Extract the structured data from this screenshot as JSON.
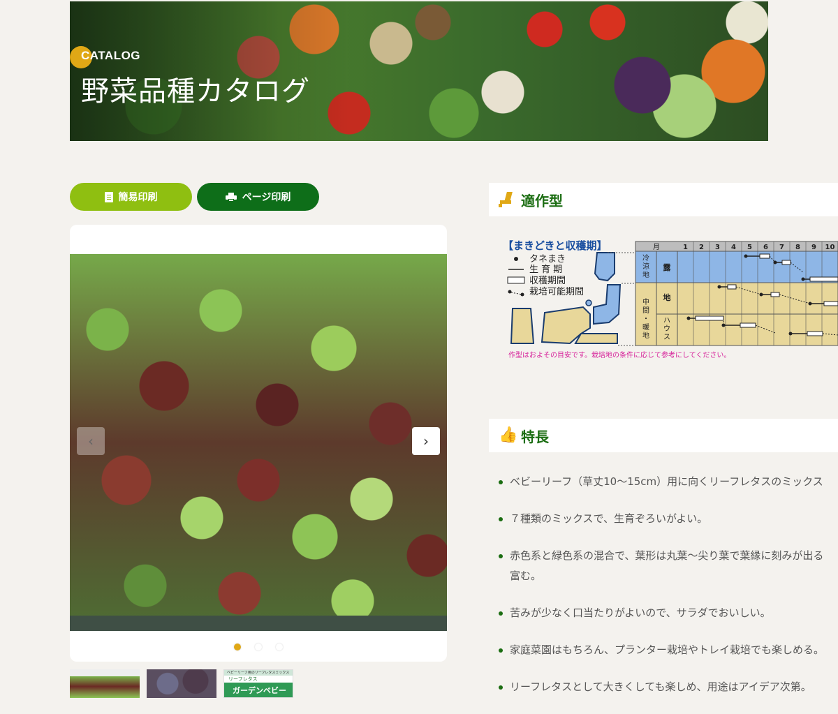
{
  "banner": {
    "category": "CATALOG",
    "title": "野菜品種カタログ"
  },
  "buttons": {
    "simple_print": "簡易印刷",
    "page_print": "ページ印刷"
  },
  "carousel": {
    "prev": "‹",
    "next": "›",
    "dots": 3,
    "active_dot": 1
  },
  "thumbnails": {
    "pkg_top": "ベビーリーフ用のリーフレタスミックス",
    "pkg_sub": "リーフレタス",
    "pkg_name": "ガーデンベビー"
  },
  "sections": {
    "cropping": {
      "title": "適作型"
    },
    "features": {
      "title": "特長"
    }
  },
  "cropping_chart": {
    "heading": "【まきどきと収穫期】",
    "legend": [
      "タネまき",
      "生 育 期",
      "収穫期間",
      "栽培可能期間"
    ],
    "month_label": "月",
    "months": [
      "1",
      "2",
      "3",
      "4",
      "5",
      "6",
      "7",
      "8",
      "9",
      "10"
    ],
    "regions": {
      "cold": "冷涼地",
      "mid": "中間・暖地"
    },
    "types": {
      "outdoor": "露",
      "ground": "地",
      "house": "ハウス"
    },
    "note": "作型はおよその目安です。栽培地の条件に応じて参考にしてください。",
    "colors": {
      "cold": "#8eb6e6",
      "mid": "#e8d79a",
      "header": "#bdbdbd"
    }
  },
  "features": [
    "ベビーリーフ（草丈10〜15cm）用に向くリーフレタスのミックス",
    "７種類のミックスで、生育ぞろいがよい。",
    "赤色系と緑色系の混合で、葉形は丸葉〜尖り葉で葉縁に刻みが出る",
    "富む。",
    "苦みが少なく口当たりがよいので、サラダでおいしい。",
    "家庭菜園はもちろん、プランター栽培やトレイ栽培でも楽しめる。",
    "リーフレタスとして大きくしても楽しめ、用途はアイデア次第。"
  ]
}
